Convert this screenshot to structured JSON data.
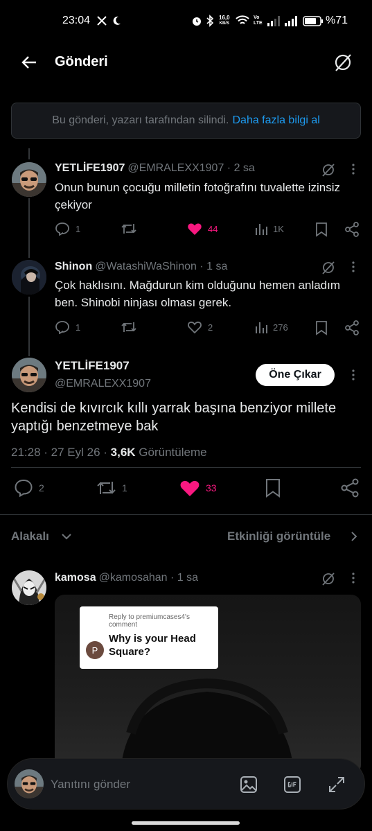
{
  "status_bar": {
    "time": "23:04",
    "net_speed_value": "16,0",
    "net_speed_unit": "KB/S",
    "volte_top": "Vo",
    "volte_bottom": "LTE",
    "battery": "%71"
  },
  "header": {
    "title": "Gönderi"
  },
  "notice": {
    "text": "Bu gönderi, yazarı tarafından silindi.",
    "link": "Daha fazla bilgi al"
  },
  "replies": [
    {
      "name": "YETLİFE1907",
      "handle": "@EMRALEXX1907 · 2 sa",
      "text": "Onun bunun çocuğu milletin fotoğrafını tuvalette izinsiz çekiyor",
      "reply_count": "1",
      "retweet_count": "",
      "like_count": "44",
      "view_count": "1K"
    },
    {
      "name": "Shinon",
      "handle": "@WatashiWaShinon · 1 sa",
      "text": "Çok haklısını. Mağdurun kim olduğunu hemen anladım ben. Shinobi ninjası olması gerek.",
      "reply_count": "1",
      "retweet_count": "",
      "like_count": "2",
      "view_count": "276"
    }
  ],
  "main_post": {
    "name": "YETLİFE1907",
    "handle": "@EMRALEXX1907",
    "follow_label": "Öne Çıkar",
    "text": "Kendisi de kıvırcık kıllı yarrak başına benziyor millete yaptığı benzetmeye bak",
    "datetime": "21:28 · 27 Eyl 26 · ",
    "views_value": "3,6K",
    "views_label": " Görüntüleme",
    "reply_count": "2",
    "retweet_count": "1",
    "like_count": "33"
  },
  "related": {
    "label": "Alakalı",
    "activity_label": "Etkinliği görüntüle"
  },
  "related_post": {
    "name": "kamosa",
    "handle": "@kamosahan · 1 sa",
    "media": {
      "reply_to": "Reply to premiumcases4's comment",
      "question": "Why is your Head Square?",
      "avatar_letter": "P"
    }
  },
  "reply_bar": {
    "placeholder": "Yanıtını gönder"
  },
  "colors": {
    "like": "#f91880",
    "link": "#1d9bf0",
    "muted": "#71767b"
  }
}
